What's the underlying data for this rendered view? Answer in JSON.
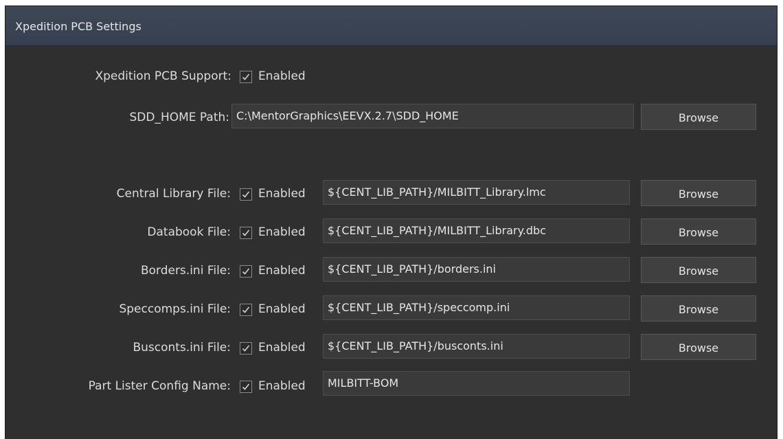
{
  "panel": {
    "title": "Xpedition PCB Settings"
  },
  "support": {
    "label": "Xpedition PCB Support:",
    "checkbox_label": "Enabled",
    "checked": true
  },
  "sdd_home": {
    "label": "SDD_HOME Path:",
    "value": "C:\\MentorGraphics\\EEVX.2.7\\SDD_HOME",
    "browse_label": "Browse"
  },
  "files": [
    {
      "label": "Central Library File:",
      "checkbox_label": "Enabled",
      "checked": true,
      "value": "${CENT_LIB_PATH}/MILBITT_Library.lmc",
      "browse_label": "Browse"
    },
    {
      "label": "Databook File:",
      "checkbox_label": "Enabled",
      "checked": true,
      "value": "${CENT_LIB_PATH}/MILBITT_Library.dbc",
      "browse_label": "Browse"
    },
    {
      "label": "Borders.ini File:",
      "checkbox_label": "Enabled",
      "checked": true,
      "value": "${CENT_LIB_PATH}/borders.ini",
      "browse_label": "Browse"
    },
    {
      "label": "Speccomps.ini File:",
      "checkbox_label": "Enabled",
      "checked": true,
      "value": "${CENT_LIB_PATH}/speccomp.ini",
      "browse_label": "Browse"
    },
    {
      "label": "Busconts.ini File:",
      "checkbox_label": "Enabled",
      "checked": true,
      "value": "${CENT_LIB_PATH}/busconts.ini",
      "browse_label": "Browse"
    }
  ],
  "part_lister": {
    "label": "Part Lister Config Name:",
    "checkbox_label": "Enabled",
    "checked": true,
    "value": "MILBITT-BOM"
  }
}
